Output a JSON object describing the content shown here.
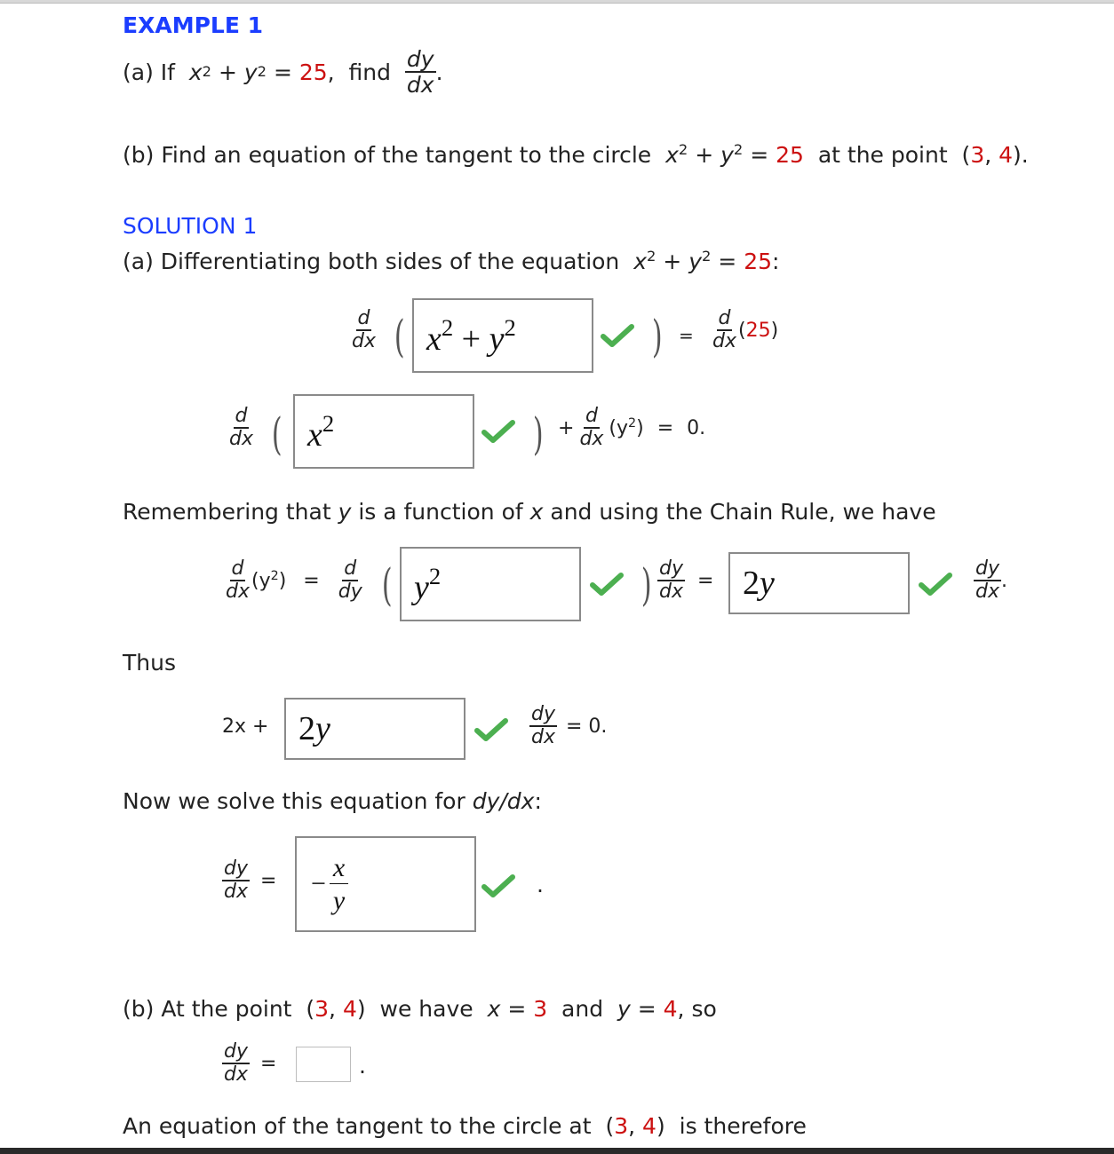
{
  "example": {
    "title": "EXAMPLE 1",
    "part_a": {
      "prefix": "(a) If",
      "eq_x": "x",
      "eq_y": "y",
      "exp": "2",
      "plus": "+",
      "equals": "=",
      "rhs": "25",
      "comma": ",",
      "find": "find",
      "frac_num": "dy",
      "frac_den": "dx",
      "period": "."
    },
    "part_b": {
      "prefix": "(b) Find an equation of the tangent to the circle",
      "eq_x": "x",
      "eq_y": "y",
      "exp": "2",
      "plus": "+",
      "equals": "=",
      "rhs": "25",
      "mid": "at the point",
      "open": "(",
      "px": "3",
      "sep": ", ",
      "py": "4",
      "close": ").",
      "full": "(b) Find an equation of the tangent to the circle x² + y² = 25 at the point (3, 4)."
    }
  },
  "solution": {
    "title": "SOLUTION 1",
    "part_a_intro": {
      "prefix": "(a) Differentiating both sides of the equation",
      "eq_x": "x",
      "eq_y": "y",
      "exp": "2",
      "plus": "+",
      "equals": "=",
      "rhs": "25",
      "colon": ":"
    },
    "step1": {
      "d_num": "d",
      "d_den": "dx",
      "input_value": {
        "base1": "x",
        "exp1": "2",
        "op": "+",
        "base2": "y",
        "exp2": "2"
      },
      "status": "correct",
      "equals": "=",
      "rhs_open": "(",
      "rhs_value": "25",
      "rhs_close": ")"
    },
    "step2": {
      "d_num": "d",
      "d_den": "dx",
      "input_value": {
        "base": "x",
        "exp": "2"
      },
      "status": "correct",
      "plus": "+",
      "term": "(y",
      "term_exp": "2",
      "term_close": ")",
      "equals": "=",
      "rhs": "0."
    },
    "chain_rule_text": "Remembering that y is a function of x and using the Chain Rule, we have",
    "chain_rule_parts": {
      "before": "Remembering that ",
      "y": "y",
      "mid": " is a function of ",
      "x": "x",
      "after": " and using the Chain Rule, we have"
    },
    "step3": {
      "lhs_num": "d",
      "lhs_den": "dx",
      "lhs_term": "(y",
      "lhs_exp": "2",
      "lhs_close": ")",
      "equals": "=",
      "d_num": "d",
      "d_den": "dy",
      "input1_value": {
        "base": "y",
        "exp": "2"
      },
      "input1_status": "correct",
      "mid_num": "dy",
      "mid_den": "dx",
      "equals2": "=",
      "input2_value": {
        "coef": "2",
        "var": "y"
      },
      "input2_status": "correct",
      "end_num": "dy",
      "end_den": "dx",
      "period": "."
    },
    "thus_label": "Thus",
    "step4": {
      "lhs": "2x +",
      "input_value": {
        "coef": "2",
        "var": "y"
      },
      "status": "correct",
      "frac_num": "dy",
      "frac_den": "dx",
      "rhs": "= 0."
    },
    "solve_text": {
      "before": "Now we solve this equation for",
      "expr": "dy/dx",
      "colon": ":"
    },
    "step5": {
      "frac_num": "dy",
      "frac_den": "dx",
      "equals": "=",
      "input_value": {
        "sign": "−",
        "num": "x",
        "den": "y"
      },
      "status": "correct",
      "period": "."
    },
    "part_b": {
      "prefix": "(b) At the point",
      "open": "(",
      "px": "3",
      "sep": ", ",
      "py": "4",
      "close": ")",
      "mid": "we have",
      "xvar": "x",
      "xeq": "=",
      "xval": "3",
      "and": "and",
      "yvar": "y",
      "yeq": "=",
      "yval": "4",
      "suffix": ", so",
      "frac_num": "dy",
      "frac_den": "dx",
      "equals": "=",
      "input_value": "",
      "period": "."
    },
    "tangent_text": {
      "before": "An equation of the tangent to the circle at",
      "open": "(",
      "px": "3",
      "sep": ", ",
      "py": "4",
      "close": ")",
      "after": "is therefore"
    }
  },
  "colors": {
    "heading_blue": "#1b3dff",
    "value_red": "#cc1111",
    "check_green": "#4caf50",
    "input_border": "#8a8a8a"
  }
}
